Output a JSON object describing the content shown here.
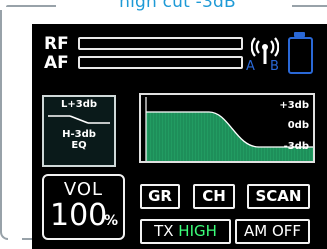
{
  "caption": "high cut  -3dB",
  "meters": [
    {
      "label": "RF",
      "level": 0.0
    },
    {
      "label": "AF",
      "level": 0.0
    }
  ],
  "status": {
    "antenna_labels": [
      "A",
      "B"
    ],
    "battery_level": 0.0,
    "antenna_icon": "antenna-signal-icon",
    "battery_icon": "battery-icon"
  },
  "eq": {
    "low": "L+3db",
    "high": "H-3db",
    "title": "EQ"
  },
  "eq_curve": {
    "labels": [
      "+3db",
      "0db",
      "-3db"
    ]
  },
  "volume": {
    "label": "VOL",
    "value": "100",
    "unit": "%"
  },
  "buttons": {
    "gr": "GR",
    "ch": "CH",
    "scan": "SCAN",
    "tx_prefix": "TX ",
    "tx_state": "HIGH",
    "am": "AM OFF"
  },
  "colors": {
    "caption": "#1e9ad6",
    "accent_green": "#3cff7a",
    "curve_fill": "#1e8f5a",
    "status_blue": "#2a68d6",
    "screen_bg": "#000000"
  }
}
